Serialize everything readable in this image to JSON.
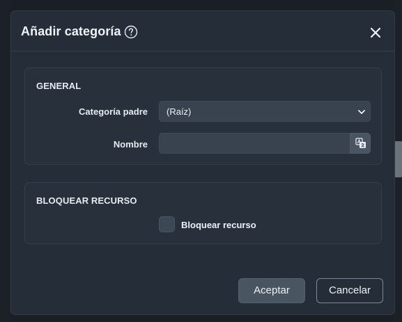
{
  "dialog": {
    "title": "Añadir categoría"
  },
  "general": {
    "section_title": "GENERAL",
    "parent_label": "Categoría padre",
    "parent_value": "(Raíz)",
    "name_label": "Nombre",
    "name_value": "",
    "name_placeholder": ""
  },
  "lock": {
    "section_title": "BLOQUEAR RECURSO",
    "checkbox_label": "Bloquear recurso",
    "checked": false
  },
  "footer": {
    "accept_label": "Aceptar",
    "cancel_label": "Cancelar"
  },
  "icons": {
    "help": "question-circle-icon",
    "close": "close-icon",
    "chevron": "chevron-down-icon",
    "translate": "translate-icon"
  },
  "colors": {
    "modal_bg": "#252d38",
    "input_bg": "#38434f",
    "accent_button": "#4a5562"
  }
}
